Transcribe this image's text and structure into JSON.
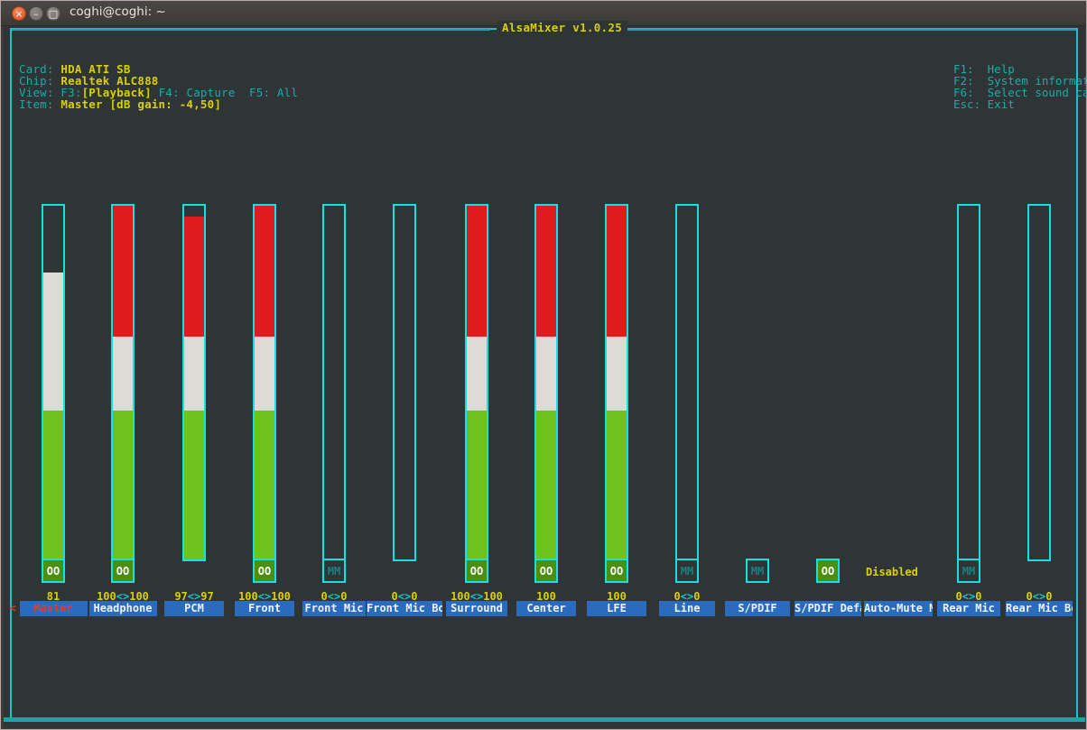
{
  "window": {
    "title": "coghi@coghi: ~",
    "buttons": {
      "close": "×",
      "minimize": "–",
      "maximize": "□"
    }
  },
  "app": {
    "frame_title": "AlsaMixer v1.0.25",
    "info": {
      "card_key": "Card:",
      "card_value": "HDA ATI SB",
      "chip_key": "Chip:",
      "chip_value": "Realtek ALC888",
      "view_key": "View:",
      "view_f3": "F3:",
      "view_playback": "[Playback]",
      "view_f4": "F4: Capture",
      "view_f5": "F5: All",
      "item_key": "Item:",
      "item_value": "Master [dB gain: -4,50]"
    },
    "help": [
      {
        "key": "F1:",
        "label": "Help"
      },
      {
        "key": "F2:",
        "label": "System information"
      },
      {
        "key": "F6:",
        "label": "Select sound card"
      },
      {
        "key": "Esc:",
        "label": "Exit"
      }
    ],
    "disabled_label": "Disabled",
    "nav_left": "<",
    "nav_right": ">"
  },
  "colors": {
    "cyan": "#17e0e0",
    "yellow": "#d8d000",
    "teal": "#1aaca8",
    "red_bar": "#e01b1b",
    "white_bar": "#dcdcd4",
    "green_bar": "#6fc21b",
    "button_blue": "#2a6bbd",
    "selected_red": "#e23b2e",
    "terminal_bg": "#2f3436"
  },
  "mixer": {
    "channels": [
      {
        "name": "Master",
        "label": "Master",
        "value_text": "81",
        "selected": true,
        "has_bar": true,
        "level_pct": 81,
        "red_pct": 0,
        "white_pct": 81,
        "mute_state": "on",
        "mute_text": "OO",
        "has_mute_box": true
      },
      {
        "name": "Headphone",
        "label": "Headphone",
        "value_text": "100<>100",
        "selected": false,
        "has_bar": true,
        "level_pct": 100,
        "red_pct": 100,
        "white_pct": 58,
        "mute_state": "on",
        "mute_text": "OO",
        "has_mute_box": true
      },
      {
        "name": "PCM",
        "label": "PCM",
        "value_text": "97<>97",
        "selected": false,
        "has_bar": true,
        "level_pct": 97,
        "red_pct": 80,
        "white_pct": 58,
        "mute_state": "none",
        "mute_text": "",
        "has_mute_box": false
      },
      {
        "name": "Front",
        "label": "Front",
        "value_text": "100<>100",
        "selected": false,
        "has_bar": true,
        "level_pct": 100,
        "red_pct": 100,
        "white_pct": 58,
        "mute_state": "on",
        "mute_text": "OO",
        "has_mute_box": true
      },
      {
        "name": "Front Mic",
        "label": "Front Mic",
        "value_text": "0<>0",
        "selected": false,
        "has_bar": true,
        "level_pct": 0,
        "red_pct": 0,
        "white_pct": 0,
        "mute_state": "off",
        "mute_text": "MM",
        "has_mute_box": true
      },
      {
        "name": "Front Mic Boost",
        "label": "Front Mic Boo",
        "value_text": "0<>0",
        "selected": false,
        "has_bar": true,
        "level_pct": 0,
        "red_pct": 0,
        "white_pct": 0,
        "mute_state": "none",
        "mute_text": "",
        "has_mute_box": false
      },
      {
        "name": "Surround",
        "label": "Surround",
        "value_text": "100<>100",
        "selected": false,
        "has_bar": true,
        "level_pct": 100,
        "red_pct": 100,
        "white_pct": 58,
        "mute_state": "on",
        "mute_text": "OO",
        "has_mute_box": true
      },
      {
        "name": "Center",
        "label": "Center",
        "value_text": "100",
        "selected": false,
        "has_bar": true,
        "level_pct": 100,
        "red_pct": 100,
        "white_pct": 58,
        "mute_state": "on",
        "mute_text": "OO",
        "has_mute_box": true
      },
      {
        "name": "LFE",
        "label": "LFE",
        "value_text": "100",
        "selected": false,
        "has_bar": true,
        "level_pct": 100,
        "red_pct": 100,
        "white_pct": 58,
        "mute_state": "on",
        "mute_text": "OO",
        "has_mute_box": true
      },
      {
        "name": "Line",
        "label": "Line",
        "value_text": "0<>0",
        "selected": false,
        "has_bar": true,
        "level_pct": 0,
        "red_pct": 0,
        "white_pct": 0,
        "mute_state": "off",
        "mute_text": "MM",
        "has_mute_box": true
      },
      {
        "name": "S/PDIF",
        "label": "S/PDIF",
        "value_text": "",
        "selected": false,
        "has_bar": false,
        "level_pct": 0,
        "red_pct": 0,
        "white_pct": 0,
        "mute_state": "off",
        "mute_text": "MM",
        "has_mute_box": true
      },
      {
        "name": "S/PDIF Default",
        "label": "S/PDIF Defau",
        "value_text": "",
        "selected": false,
        "has_bar": false,
        "level_pct": 0,
        "red_pct": 0,
        "white_pct": 0,
        "mute_state": "on",
        "mute_text": "OO",
        "has_mute_box": true
      },
      {
        "name": "Auto-Mute Mode",
        "label": "Auto-Mute Mo",
        "value_text": "",
        "selected": false,
        "has_bar": false,
        "level_pct": 0,
        "red_pct": 0,
        "white_pct": 0,
        "mute_state": "text",
        "mute_text": "Disabled",
        "has_mute_box": false
      },
      {
        "name": "Rear Mic",
        "label": "Rear Mic",
        "value_text": "0<>0",
        "selected": false,
        "has_bar": true,
        "level_pct": 0,
        "red_pct": 0,
        "white_pct": 0,
        "mute_state": "off",
        "mute_text": "MM",
        "has_mute_box": true
      },
      {
        "name": "Rear Mic Boost",
        "label": "Rear Mic Boo",
        "value_text": "0<>0",
        "selected": false,
        "has_bar": true,
        "level_pct": 0,
        "red_pct": 0,
        "white_pct": 0,
        "mute_state": "none",
        "mute_text": "",
        "has_mute_box": false
      }
    ]
  }
}
